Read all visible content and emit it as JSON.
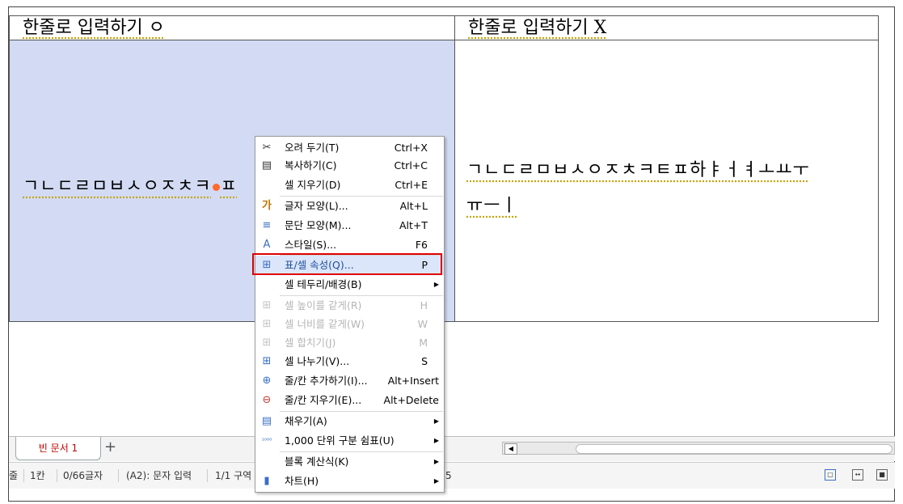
{
  "document": {
    "table": {
      "header_left": "한줄로 입력하기 ㅇ",
      "header_right": "한줄로 입력하기 X",
      "cell_a2_text_before_cursor": "ㄱㄴㄷㄹㅁㅂㅅㅇㅈㅊㅋ",
      "cell_a2_text_after_cursor": "ㅍ",
      "cell_b2_line1": "ㄱㄴㄷㄹㅁㅂㅅㅇㅈㅊㅋㅌㅍ하ㅑㅓㅕㅗㅛㅜ",
      "cell_b2_line2": "ㅠㅡㅣ"
    }
  },
  "context_menu": {
    "items": [
      {
        "icon": "scissors-icon",
        "glyph": "✂",
        "label": "오려 두기(T)",
        "shortcut": "Ctrl+X",
        "enabled": true
      },
      {
        "icon": "copy-icon",
        "glyph": "▤",
        "label": "복사하기(C)",
        "shortcut": "Ctrl+C",
        "enabled": true
      },
      {
        "icon": "",
        "glyph": "",
        "label": "셀 지우기(D)",
        "shortcut": "Ctrl+E",
        "enabled": true
      },
      {
        "icon": "char-shape-icon",
        "glyph": "가",
        "label": "글자 모양(L)...",
        "shortcut": "Alt+L",
        "enabled": true
      },
      {
        "icon": "para-shape-icon",
        "glyph": "≡",
        "label": "문단 모양(M)...",
        "shortcut": "Alt+T",
        "enabled": true
      },
      {
        "icon": "style-icon",
        "glyph": "A",
        "label": "스타일(S)...",
        "shortcut": "F6",
        "enabled": true
      },
      {
        "icon": "table-props-icon",
        "glyph": "⊞",
        "label": "표/셀 속성(Q)...",
        "shortcut": "P",
        "enabled": true,
        "highlighted": true
      },
      {
        "icon": "",
        "glyph": "",
        "label": "셀 테두리/배경(B)",
        "shortcut": "",
        "enabled": true,
        "submenu": true
      },
      {
        "icon": "equal-height-icon",
        "glyph": "⊞",
        "label": "셀 높이를 같게(R)",
        "shortcut": "H",
        "enabled": false
      },
      {
        "icon": "equal-width-icon",
        "glyph": "⊞",
        "label": "셀 너비를 같게(W)",
        "shortcut": "W",
        "enabled": false
      },
      {
        "icon": "merge-cells-icon",
        "glyph": "⊞",
        "label": "셀 합치기(J)",
        "shortcut": "M",
        "enabled": false
      },
      {
        "icon": "split-cells-icon",
        "glyph": "⊞",
        "label": "셀 나누기(V)...",
        "shortcut": "S",
        "enabled": true
      },
      {
        "icon": "insert-row-col-icon",
        "glyph": "⊕",
        "label": "줄/칸 추가하기(I)...",
        "shortcut": "Alt+Insert",
        "enabled": true
      },
      {
        "icon": "delete-row-col-icon",
        "glyph": "⊖",
        "label": "줄/칸 지우기(E)...",
        "shortcut": "Alt+Delete",
        "enabled": true
      },
      {
        "icon": "fill-icon",
        "glyph": "▤",
        "label": "채우기(A)",
        "shortcut": "",
        "enabled": true,
        "submenu": true
      },
      {
        "icon": "thousands-sep-icon",
        "glyph": "¹⁰⁰⁰",
        "label": "1,000 단위 구분 쉼표(U)",
        "shortcut": "",
        "enabled": true,
        "submenu": true
      },
      {
        "icon": "",
        "glyph": "",
        "label": "블록 계산식(K)",
        "shortcut": "",
        "enabled": true,
        "submenu": true
      },
      {
        "icon": "chart-icon",
        "glyph": "▮",
        "label": "차트(H)",
        "shortcut": "",
        "enabled": true,
        "submenu": true
      }
    ]
  },
  "tabs": {
    "doc_tab_label": "빈 문서 1",
    "add_tab_label": "+"
  },
  "statusbar": {
    "partial_left": "줄",
    "column": "1칸",
    "char_count": "0/66글자",
    "cell_info": "(A2): 문자 입력",
    "section": "1/1 구역",
    "partial_right": "5"
  },
  "colors": {
    "selected_cell_bg": "#d2dbf3",
    "highlight_border": "#e00000",
    "menu_highlight_bg": "#dbe6fa"
  }
}
